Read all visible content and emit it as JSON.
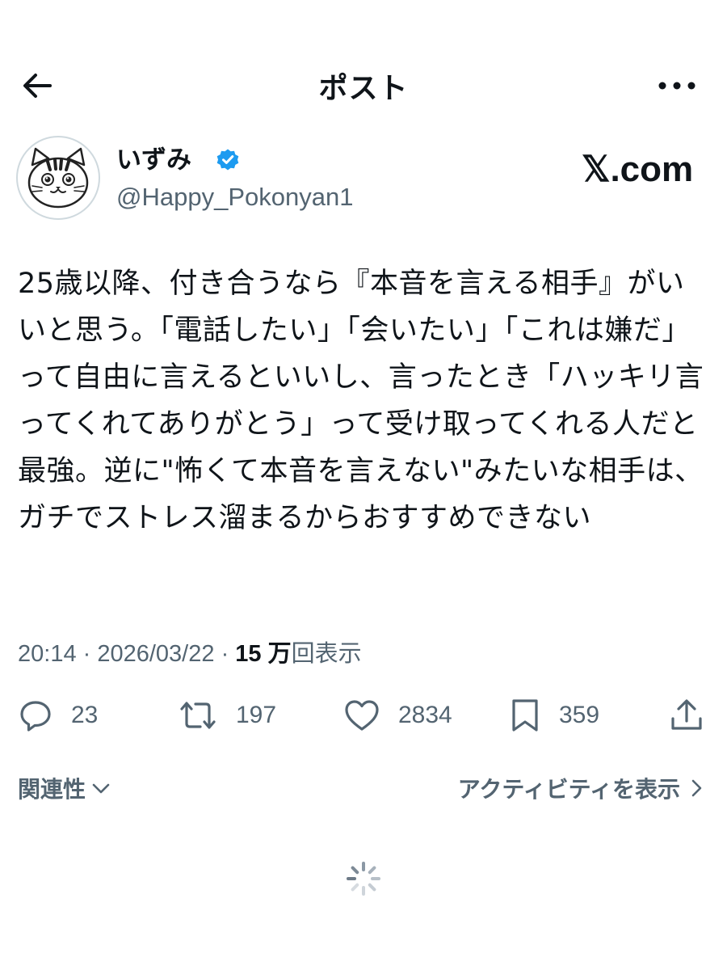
{
  "header": {
    "title": "ポスト",
    "back_icon": "arrow-left-icon",
    "more_icon": "more-horizontal-icon"
  },
  "author": {
    "display_name": "いずみ",
    "handle": "@Happy_Pokonyan1",
    "verified": true,
    "verified_color": "#1d9bf0",
    "avatar_icon": "cat-face-avatar"
  },
  "brand": {
    "logo_text": "𝕏.com"
  },
  "tweet": {
    "text": "25歳以降、付き合うなら『本音を言える相手』がいいと思う。「電話したい」「会いたい」「これは嫌だ」って自由に言えるといいし、言ったとき「ハッキリ言ってくれてありがとう」って受け取ってくれる人だと最強。逆に\"怖くて本音を言えない\"みたいな相手は、ガチでストレス溜まるからおすすめできない"
  },
  "meta": {
    "time": "20:14",
    "separator": " · ",
    "date": "2026/03/22",
    "views_count": "15 万",
    "views_label": "回表示"
  },
  "actions": {
    "replies": "23",
    "reposts": "197",
    "likes": "2834",
    "bookmarks": "359"
  },
  "footer": {
    "relevance_label": "関連性",
    "activity_label": "アクティビティを表示"
  },
  "colors": {
    "text_primary": "#0f1419",
    "text_secondary": "#536471",
    "accent": "#1d9bf0"
  }
}
